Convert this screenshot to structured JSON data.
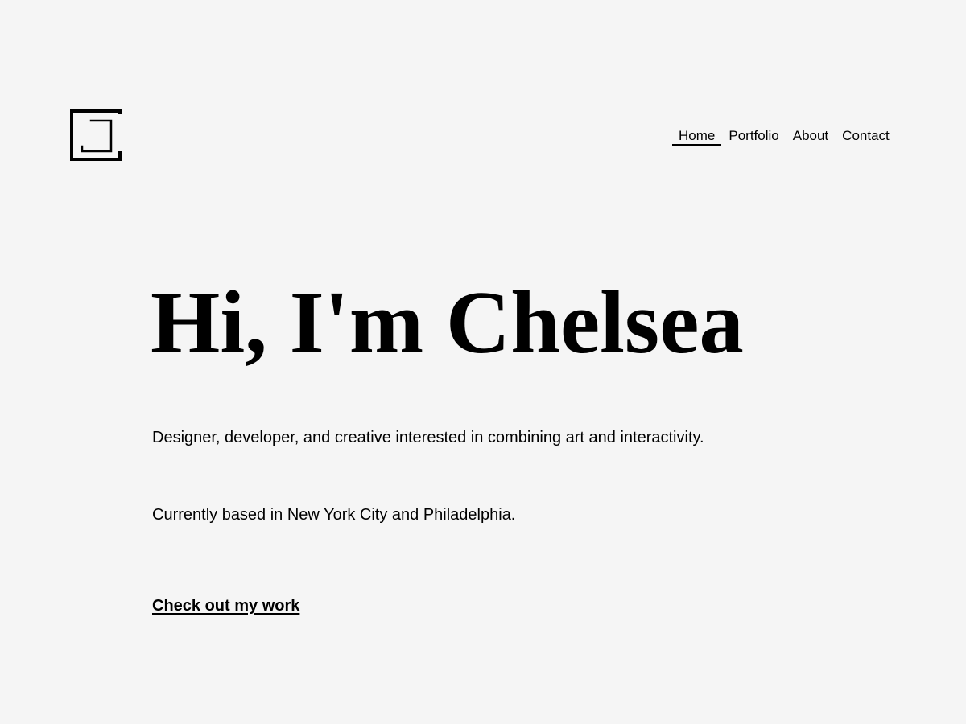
{
  "header": {
    "logo_icon": "bracket-frame-logo-icon",
    "nav": {
      "home": "Home",
      "portfolio": "Portfolio",
      "about": "About",
      "contact": "Contact"
    }
  },
  "hero": {
    "title": "Hi, I'm Chelsea",
    "tagline": "Designer, developer, and creative interested in combining art and interactivity.",
    "location": "Currently based in New York City and Philadelphia.",
    "cta": "Check out my work"
  },
  "colors": {
    "background": "#f5f5f5",
    "text": "#000000"
  }
}
